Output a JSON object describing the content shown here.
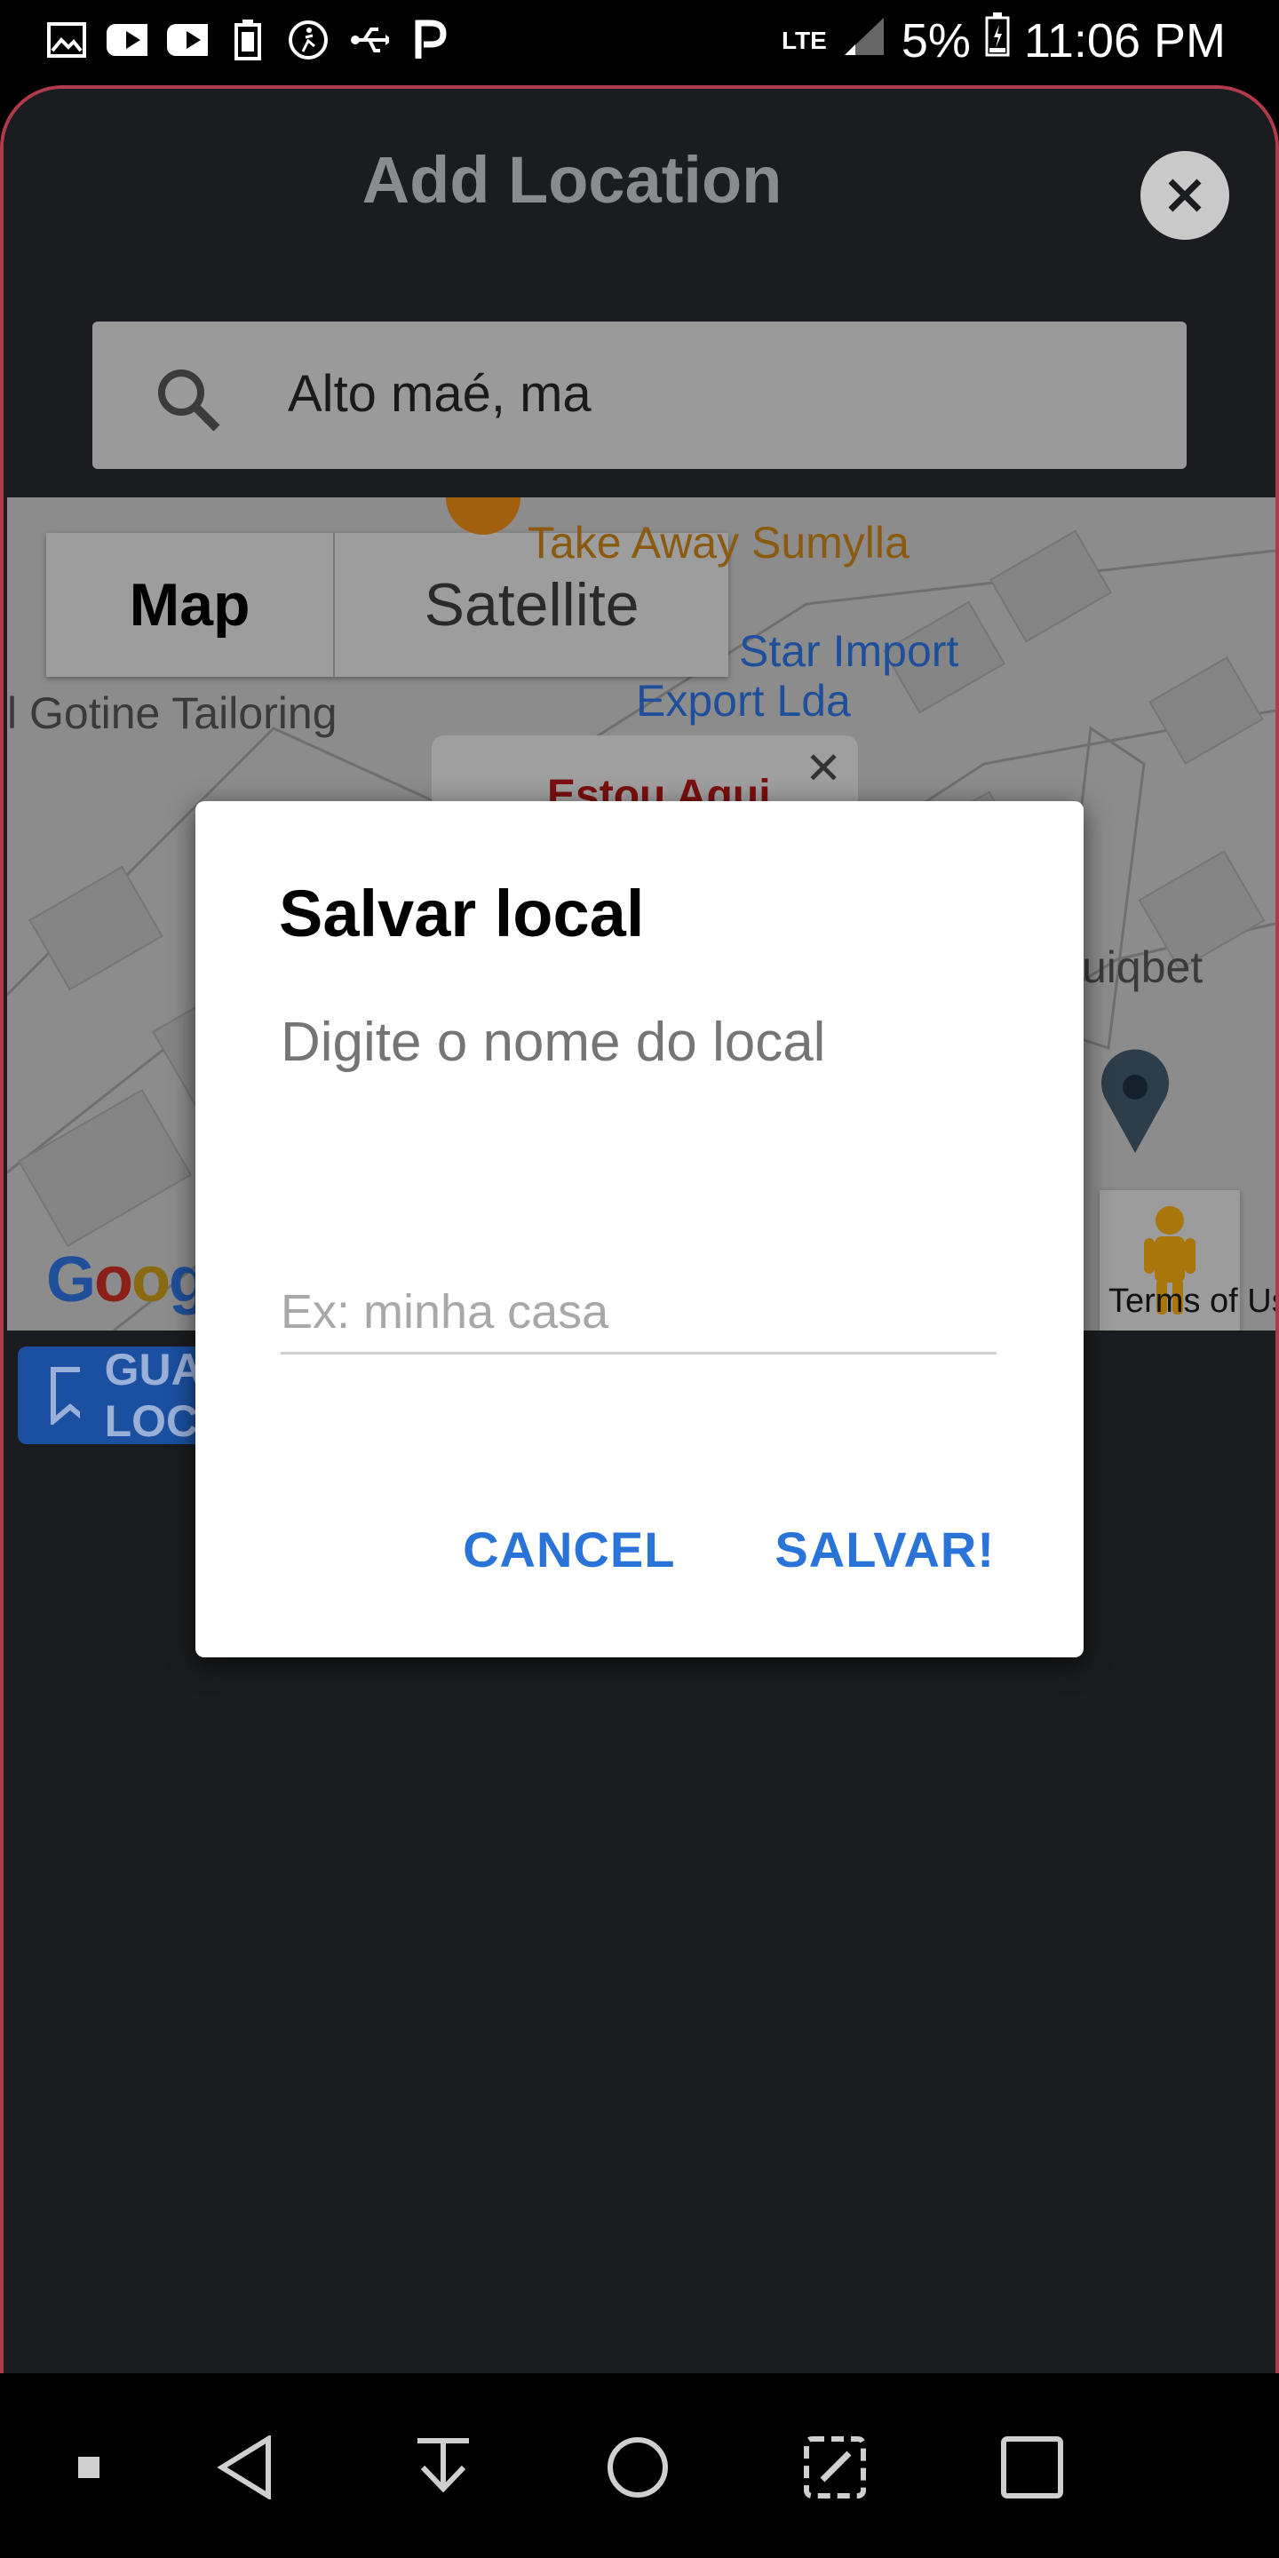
{
  "status_bar": {
    "network": "LTE",
    "battery_percent": "5%",
    "time": "11:06 PM"
  },
  "header": {
    "title": "Add Location"
  },
  "search": {
    "value": "Alto maé, ma"
  },
  "map": {
    "type_buttons": {
      "map": "Map",
      "satellite": "Satellite"
    },
    "labels": {
      "restaurant": "Take Away Sumylla",
      "star_import_1": "Star Import",
      "star_import_2": "Export Lda",
      "tailoring": "l Gotine Tailoring",
      "uiqbet": "uiqbet"
    },
    "info_window": "Estou Aqui",
    "google": "Google",
    "terms": "Terms of Use"
  },
  "save_location_button": "GUARDAR LOCAL",
  "dialog": {
    "title": "Salvar local",
    "message": "Digite o nome do local",
    "input_placeholder": "Ex: minha casa",
    "cancel": "CANCEL",
    "confirm": "SALVAR!"
  },
  "colors": {
    "accent": "#2a73d9",
    "frame_border": "#b03a4a",
    "background": "#1b1c1f"
  }
}
